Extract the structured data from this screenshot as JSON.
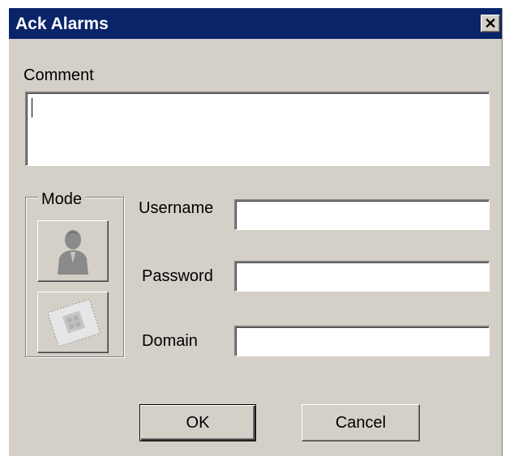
{
  "window": {
    "title": "Ack Alarms",
    "close_symbol": "✕",
    "colors": {
      "titlebar": "#0a246a",
      "face": "#d4d0c8"
    }
  },
  "comment": {
    "label": "Comment",
    "value": ""
  },
  "mode": {
    "label": "Mode",
    "buttons": [
      {
        "icon": "user-icon"
      },
      {
        "icon": "smart-card-icon"
      }
    ]
  },
  "fields": {
    "username": {
      "label": "Username",
      "value": ""
    },
    "password": {
      "label": "Password",
      "value": ""
    },
    "domain": {
      "label": "Domain",
      "value": ""
    }
  },
  "buttons": {
    "ok": "OK",
    "cancel": "Cancel"
  }
}
